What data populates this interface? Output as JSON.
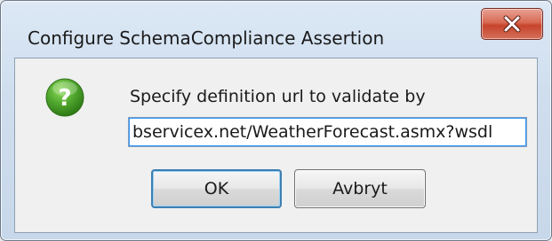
{
  "dialog": {
    "title": "Configure SchemaCompliance Assertion",
    "close_icon": "close-x-icon",
    "prompt_icon": "question-mark-icon",
    "prompt": "Specify definition url to validate by",
    "url_value": "bservicex.net/WeatherForecast.asmx?wsdl",
    "ok_label": "OK",
    "cancel_label": "Avbryt"
  },
  "colors": {
    "close_button": "#c7432c",
    "question_icon": "#4fa62d",
    "input_focus": "#3399ff",
    "default_button_border": "#3c7fb1"
  }
}
